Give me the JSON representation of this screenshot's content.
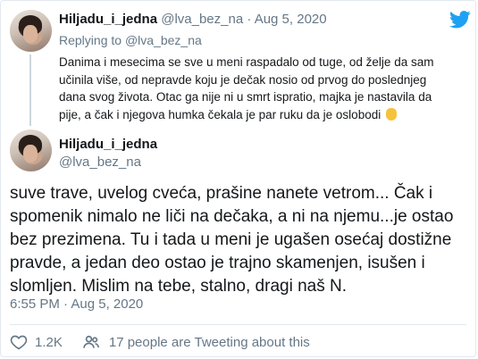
{
  "reply": {
    "display_name": "Hiljadu_i_jedna",
    "handle": "@lva_bez_na",
    "separator": "·",
    "date": "Aug 5, 2020",
    "replying_prefix": "Replying to",
    "replying_to": "@lva_bez_na",
    "text_lines": [
      "Danima i mesecima se sve u meni raspadalo od tuge, od želje da sam",
      "učinila više, od nepravde koju je dečak nosio od prvog do poslednjeg",
      "dana svog života. Otac ga nije ni u smrt ispratio, majka je nastavila da",
      "pije, a čak i njegova humka čekala je par ruku da je oslobodi"
    ],
    "emoji": "backhand-index-pointing-down"
  },
  "tweet": {
    "display_name": "Hiljadu_i_jedna",
    "handle": "@lva_bez_na",
    "text_lines": [
      "suve trave, uvelog cveća, prašine nanete vetrom... Čak i",
      "spomenik nimalo ne liči na dečaka, a ni na njemu...je ostao",
      "bez prezimena. Tu i tada u meni je ugašen osećaj dostižne",
      "pravde, a jedan deo ostao je trajno skamenjen, isušen i",
      "slomljen. Mislim na tebe, stalno, dragi naš N."
    ],
    "timestamp": "6:55 PM · Aug 5, 2020",
    "likes": "1.2K",
    "people_tweeting": "17 people are Tweeting about this"
  },
  "colors": {
    "brand": "#1da1f2",
    "muted": "#657786",
    "text": "#14171a",
    "border": "#e1e8ed"
  }
}
